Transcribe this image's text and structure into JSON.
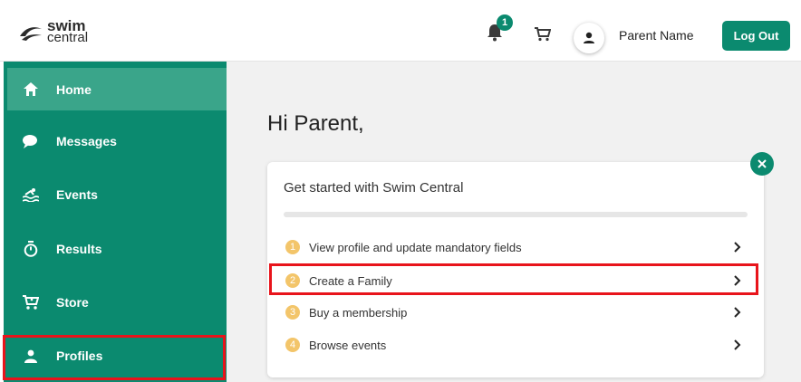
{
  "header": {
    "logo_line1": "swim",
    "logo_line2": "central",
    "notification_count": "1",
    "user_name": "Parent Name",
    "logout_label": "Log Out"
  },
  "sidebar": {
    "items": [
      {
        "label": "Home",
        "icon": "home-icon"
      },
      {
        "label": "Messages",
        "icon": "chat-icon"
      },
      {
        "label": "Events",
        "icon": "swim-icon"
      },
      {
        "label": "Results",
        "icon": "stopwatch-icon"
      },
      {
        "label": "Store",
        "icon": "cart-icon"
      },
      {
        "label": "Profiles",
        "icon": "person-icon"
      }
    ]
  },
  "main": {
    "greeting": "Hi Parent,",
    "card": {
      "title": "Get started with Swim Central",
      "steps": [
        {
          "num": "1",
          "label": "View profile and update mandatory fields"
        },
        {
          "num": "2",
          "label": "Create a Family"
        },
        {
          "num": "3",
          "label": "Buy a membership"
        },
        {
          "num": "4",
          "label": "Browse events"
        }
      ]
    }
  },
  "colors": {
    "brand": "#0b8a6f",
    "active": "#3aa58a",
    "highlight": "#e8141b",
    "step_badge": "#f3c56a"
  }
}
